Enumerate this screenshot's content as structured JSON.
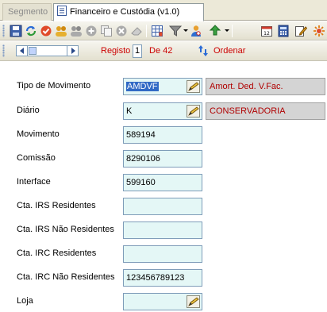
{
  "tabs": [
    {
      "label": "Segmento"
    },
    {
      "label": "Financeiro e Custódia (v1.0)"
    }
  ],
  "toolbar": {
    "icons": [
      "save-icon",
      "refresh-icon",
      "approve-icon",
      "users-icon",
      "users-gray-icon",
      "add-icon",
      "copy-icon",
      "delete-icon",
      "eraser-icon",
      "grid-icon",
      "filter-icon",
      "person-search-icon",
      "export-icon",
      "calendar-icon",
      "calculator-icon",
      "edit-icon",
      "settings-icon"
    ]
  },
  "navigation": {
    "record_label": "Registo",
    "record_number": "1",
    "record_total": "De 42",
    "sort_label": "Ordenar",
    "scroll_position": 0.0
  },
  "form": {
    "tipo_movimento": {
      "label": "Tipo de Movimento",
      "value": "AMDVF",
      "description": "Amort. Ded. V.Fac."
    },
    "diario": {
      "label": "Diário",
      "value": "K",
      "description": "CONSERVADORIA"
    },
    "movimento": {
      "label": "Movimento",
      "value": "589194"
    },
    "comissao": {
      "label": "Comissão",
      "value": "8290106"
    },
    "interface": {
      "label": "Interface",
      "value": "599160"
    },
    "cta_irs_residentes": {
      "label": "Cta. IRS Residentes",
      "value": ""
    },
    "cta_irs_nao_residentes": {
      "label": "Cta. IRS Não Residentes",
      "value": ""
    },
    "cta_irc_residentes": {
      "label": "Cta. IRC Residentes",
      "value": ""
    },
    "cta_irc_nao_residentes": {
      "label": "Cta. IRC Não Residentes",
      "value": "123456789123"
    },
    "loja": {
      "label": "Loja",
      "value": ""
    }
  },
  "colors": {
    "field_bg": "#e4f7f6",
    "desc_bg": "#d4d4d4",
    "desc_text": "#b00000",
    "nav_text": "#cc0000"
  }
}
